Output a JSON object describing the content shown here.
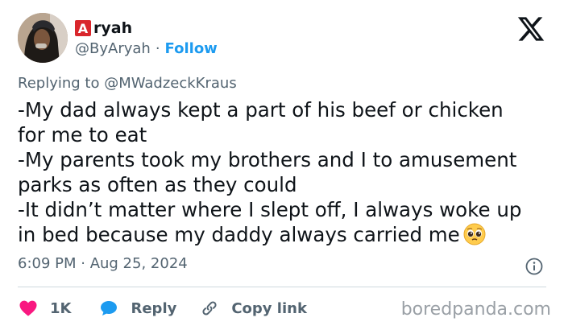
{
  "author": {
    "name_initial": "A",
    "name_rest": "ryah",
    "handle": "@ByAryah",
    "separator": "·",
    "follow_label": "Follow",
    "avatar_icon": "profile-photo"
  },
  "header": {
    "logo_icon": "x-logo"
  },
  "replying_to": "Replying to @MWadzeckKraus",
  "tweet": {
    "lines": [
      "-My dad always kept a part of his beef or chicken",
      "for me to eat",
      "-My parents took my brothers and I to amusement",
      "parks as often as they could",
      "-It didn’t matter where I slept off, I always woke up",
      "in bed because my daddy always carried me"
    ],
    "emoji_icon": "pleading-face-emoji"
  },
  "meta": {
    "timestamp": "6:09 PM · Aug 25, 2024",
    "info_icon": "info-icon"
  },
  "actions": {
    "like_count": "1K",
    "reply_label": "Reply",
    "copy_link_label": "Copy link"
  },
  "watermark": "boredpanda.com",
  "colors": {
    "accent_blue": "#1d9bf0",
    "like_red": "#f91880",
    "muted_text": "#536471",
    "initial_badge": "#d9262c"
  }
}
